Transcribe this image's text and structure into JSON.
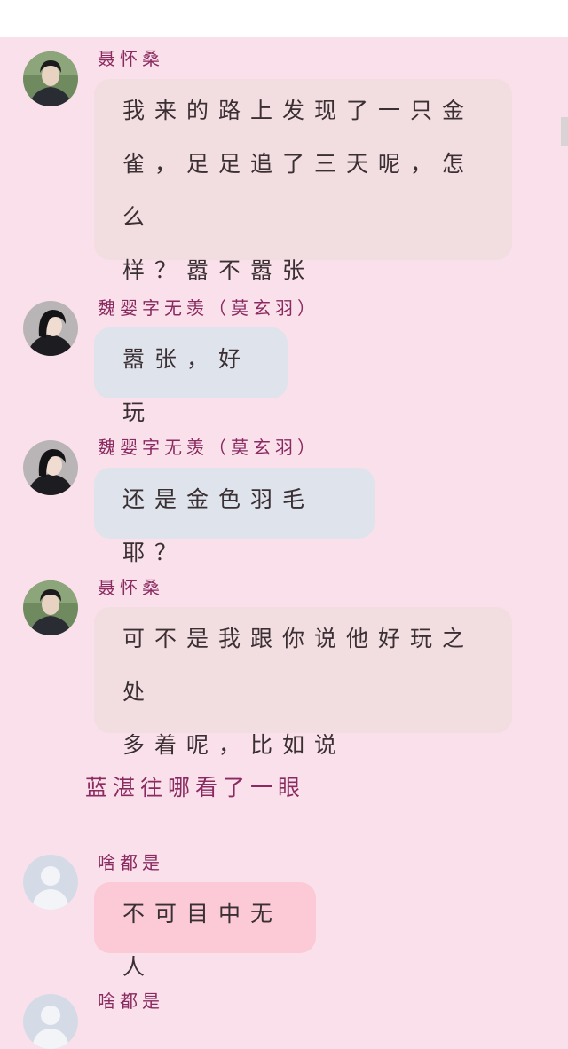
{
  "messages": [
    {
      "sender": "聂怀桑",
      "lines": [
        "我来的路上发现了一只金",
        "雀，足足追了三天呢，怎么",
        "样？嚣不嚣张"
      ]
    },
    {
      "sender": "魏婴字无羡（莫玄羽）",
      "lines": [
        "嚣张，好玩"
      ]
    },
    {
      "sender": "魏婴字无羡（莫玄羽）",
      "lines": [
        "还是金色羽毛耶？"
      ]
    },
    {
      "sender": "聂怀桑",
      "lines": [
        "可不是我跟你说他好玩之处",
        "多着呢，比如说"
      ]
    },
    {
      "narration": "蓝湛往哪看了一眼"
    },
    {
      "sender": "啥都是",
      "lines": [
        "不可目中无人"
      ]
    },
    {
      "sender": "啥都是"
    }
  ],
  "colors": {
    "background": "#f9e0ea",
    "sender_name": "#8a2a60",
    "bubble_beige": "#f2dde1",
    "bubble_blue": "#dfe3ec",
    "bubble_pink": "#fbcad6"
  },
  "icons": {
    "nie_avatar": "person-photo-avatar",
    "wei_avatar": "person-photo-avatar",
    "default_avatar": "default-user-avatar"
  }
}
